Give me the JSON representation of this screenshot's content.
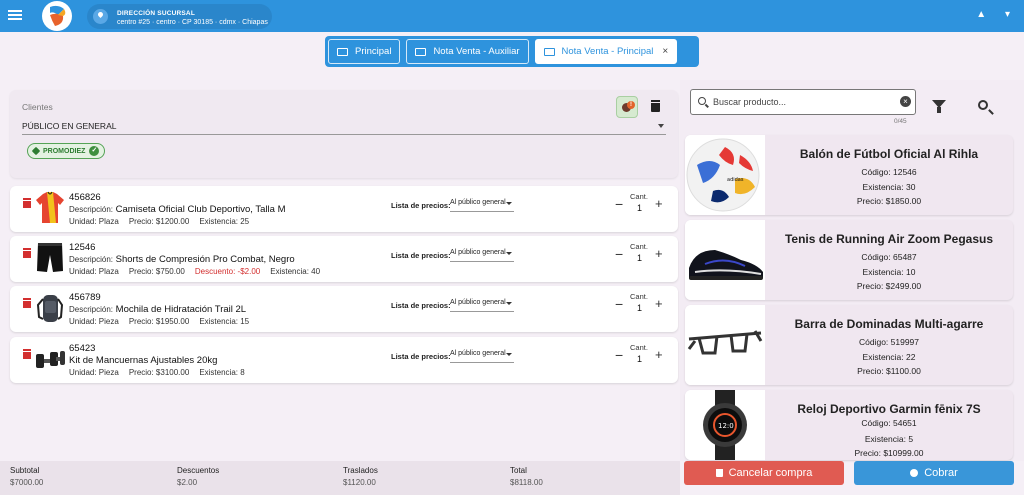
{
  "header": {
    "branch_title": "DIRECCIÓN SUCURSAL",
    "branch_address": "centro #25 · centro · CP 30185 · cdmx · Chiapas",
    "right_icons": [
      "chevron-up-icon",
      "menu-down-icon"
    ]
  },
  "tabs": [
    {
      "label": "Principal",
      "active": false
    },
    {
      "label": "Nota Venta - Auxiliar",
      "active": false
    },
    {
      "label": "Nota Venta - Principal",
      "active": true,
      "close": "×"
    }
  ],
  "client": {
    "label": "Clientes",
    "value": "PÚBLICO EN GENERAL",
    "promo_chip": "PROMODIEZ",
    "alert_badge": "!"
  },
  "items": [
    {
      "code": "456826",
      "desc_prefix": "Descripción:",
      "description": "Camiseta Oficial Club Deportivo, Talla M",
      "unit": "Unidad: Plaza",
      "price": "Precio: $1200.00",
      "discount": "",
      "stock": "Existencia: 25",
      "price_list_label": "Lista de precios:",
      "price_list": "Al público general",
      "qty_label": "Cant.",
      "qty": "1"
    },
    {
      "code": "12546",
      "desc_prefix": "Descripción:",
      "description": "Shorts de Compresión Pro Combat, Negro",
      "unit": "Unidad: Plaza",
      "price": "Precio: $750.00",
      "discount": "Descuento: -$2.00",
      "stock": "Existencia: 40",
      "price_list_label": "Lista de precios:",
      "price_list": "Al público general",
      "qty_label": "Cant.",
      "qty": "1"
    },
    {
      "code": "456789",
      "desc_prefix": "Descripción:",
      "description": "Mochila de Hidratación Trail 2L",
      "unit": "Unidad: Pieza",
      "price": "Precio: $1950.00",
      "discount": "",
      "stock": "Existencia: 15",
      "price_list_label": "Lista de precios:",
      "price_list": "Al público general",
      "qty_label": "Cant.",
      "qty": "1"
    },
    {
      "code": "65423",
      "desc_prefix": "",
      "description": "Kit de Mancuernas Ajustables 20kg",
      "unit": "Unidad: Pieza",
      "price": "Precio: $3100.00",
      "discount": "",
      "stock": "Existencia: 8",
      "price_list_label": "Lista de precios:",
      "price_list": "Al público general",
      "qty_label": "Cant.",
      "qty": "1"
    }
  ],
  "search": {
    "placeholder": "Buscar producto...",
    "count": "0/45"
  },
  "products": [
    {
      "name": "Balón de Fútbol Oficial Al Rihla",
      "code": "Código: 12546",
      "stock": "Existencia: 30",
      "price": "Precio: $1850.00"
    },
    {
      "name": "Tenis de Running Air Zoom Pegasus",
      "code": "Código: 65487",
      "stock": "Existencia: 10",
      "price": "Precio: $2499.00"
    },
    {
      "name": "Barra de Dominadas Multi-agarre",
      "code": "Código: 519997",
      "stock": "Existencia: 22",
      "price": "Precio: $1100.00"
    },
    {
      "name": "Reloj Deportivo Garmin fēnix 7S",
      "code": "Código: 54651",
      "stock": "Existencia: 5",
      "price": "Precio: $10999.00"
    }
  ],
  "totals": [
    {
      "label": "Subtotal",
      "value": "$7000.00"
    },
    {
      "label": "Descuentos",
      "value": "$2.00"
    },
    {
      "label": "Traslados",
      "value": "$1120.00"
    },
    {
      "label": "Total",
      "value": "$8118.00"
    }
  ],
  "actions": {
    "cancel": "Cancelar compra",
    "pay": "Cobrar"
  },
  "colors": {
    "primary": "#2e93dd",
    "cancel": "#e05b52",
    "pay": "#3996d9",
    "discount": "#d32f2f"
  }
}
